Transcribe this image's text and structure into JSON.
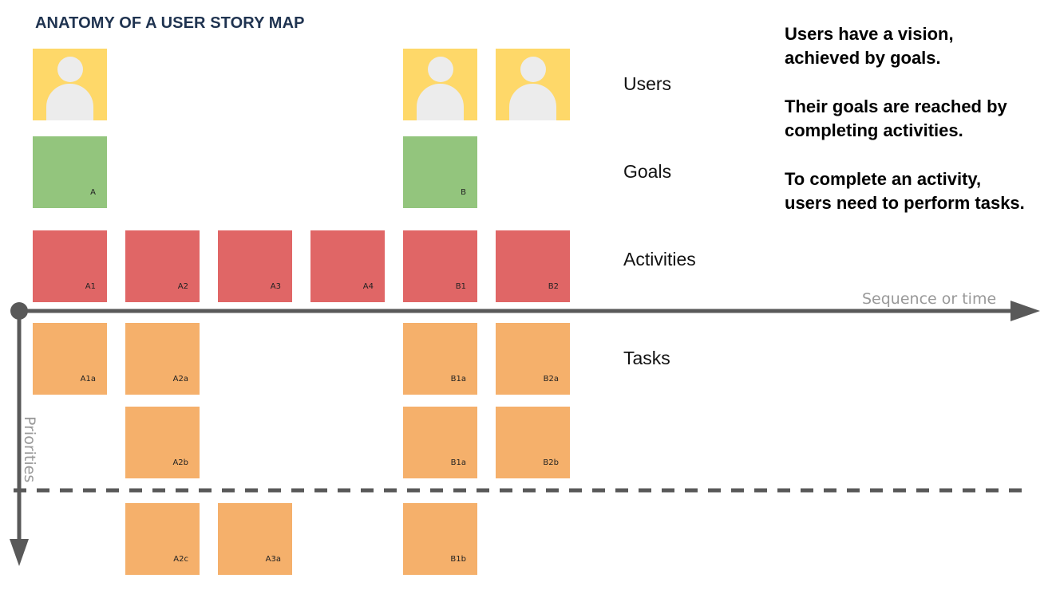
{
  "title": "ANATOMY OF A USER STORY MAP",
  "row_labels": {
    "users": "Users",
    "goals": "Goals",
    "activities": "Activities",
    "tasks": "Tasks"
  },
  "notes": [
    "Users have a vision, achieved by goals.",
    "Their goals are reached by completing activities.",
    "To complete an activity, users need to perform tasks."
  ],
  "axes": {
    "horizontal": "Sequence or time",
    "vertical": "Priorities"
  },
  "colors": {
    "user": "#fed869",
    "goal": "#93c57d",
    "activity": "#e06666",
    "task": "#f5b06b",
    "axis": "#595959"
  },
  "goals": [
    "A",
    "B"
  ],
  "activities": [
    "A1",
    "A2",
    "A3",
    "A4",
    "B1",
    "B2"
  ],
  "tasks": {
    "row1": [
      "A1a",
      "A2a",
      "B1a",
      "B2a"
    ],
    "row2": [
      "A2b",
      "B1a",
      "B2b"
    ],
    "below_line": [
      "A2c",
      "A3a",
      "B1b"
    ]
  }
}
